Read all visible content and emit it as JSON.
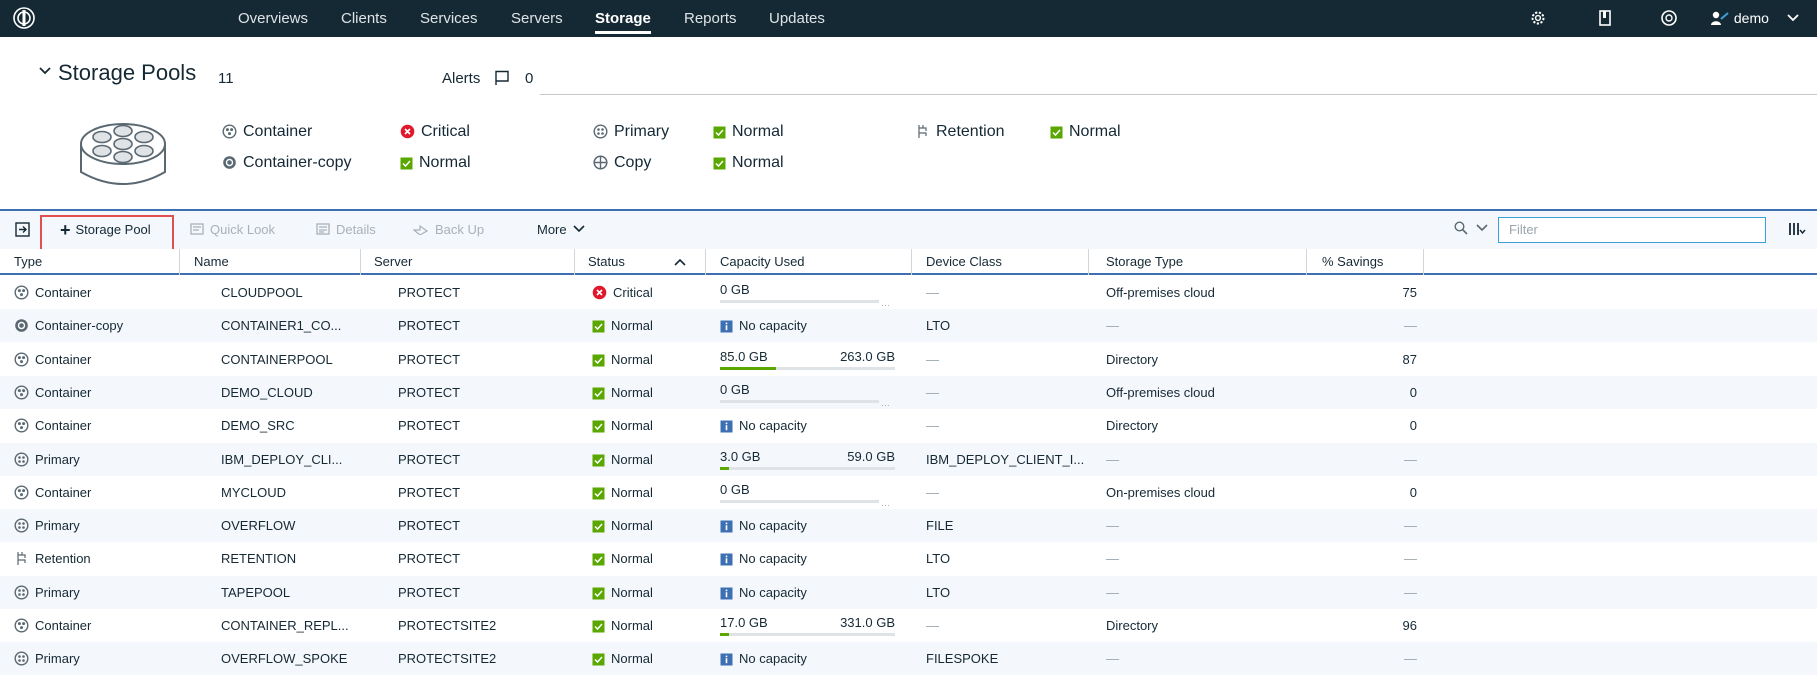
{
  "nav": {
    "items": [
      {
        "label": "Overviews"
      },
      {
        "label": "Clients"
      },
      {
        "label": "Services"
      },
      {
        "label": "Servers"
      },
      {
        "label": "Storage"
      },
      {
        "label": "Reports"
      },
      {
        "label": "Updates"
      }
    ],
    "active": "Storage",
    "user": "demo",
    "icons": [
      "gear-icon",
      "book-icon",
      "globe-icon",
      "user-icon"
    ]
  },
  "header": {
    "title": "Storage Pools",
    "count": "11",
    "alerts_label": "Alerts",
    "alerts_count": "0"
  },
  "summary": {
    "types": [
      {
        "label": "Container",
        "icon": "container-icon",
        "status": "Critical"
      },
      {
        "label": "Container-copy",
        "icon": "container-copy-icon",
        "status": "Normal"
      },
      {
        "label": "Primary",
        "icon": "primary-icon",
        "status": "Normal"
      },
      {
        "label": "Copy",
        "icon": "copy-icon",
        "status": "Normal"
      },
      {
        "label": "Retention",
        "icon": "retention-icon",
        "status": "Normal"
      }
    ]
  },
  "toolbar": {
    "add_storage_pool": "Storage Pool",
    "quick_look": "Quick Look",
    "details": "Details",
    "back_up": "Back Up",
    "more": "More",
    "filter_placeholder": "Filter"
  },
  "table": {
    "columns": [
      "Type",
      "Name",
      "Server",
      "Status",
      "Capacity Used",
      "Device Class",
      "Storage Type",
      "% Savings"
    ],
    "no_capacity_label": "No capacity",
    "rows": [
      {
        "type": "Container",
        "name": "CLOUDPOOL",
        "server": "PROTECT",
        "status": "Critical",
        "cap_used": "0 GB",
        "cap_total": "",
        "cap_fraction": 0,
        "cap_kind": "dotted",
        "device_class": "—",
        "storage_type": "Off-premises cloud",
        "savings": "75"
      },
      {
        "type": "Container-copy",
        "name": "CONTAINER1_CO...",
        "server": "PROTECT",
        "status": "Normal",
        "cap_used": "",
        "cap_total": "",
        "cap_fraction": 0,
        "cap_kind": "none",
        "device_class": "LTO",
        "storage_type": "—",
        "savings": "—"
      },
      {
        "type": "Container",
        "name": "CONTAINERPOOL",
        "server": "PROTECT",
        "status": "Normal",
        "cap_used": "85.0 GB",
        "cap_total": "263.0 GB",
        "cap_fraction": 0.32,
        "cap_kind": "bar",
        "device_class": "—",
        "storage_type": "Directory",
        "savings": "87"
      },
      {
        "type": "Container",
        "name": "DEMO_CLOUD",
        "server": "PROTECT",
        "status": "Normal",
        "cap_used": "0 GB",
        "cap_total": "",
        "cap_fraction": 0,
        "cap_kind": "dotted",
        "device_class": "—",
        "storage_type": "Off-premises cloud",
        "savings": "0"
      },
      {
        "type": "Container",
        "name": "DEMO_SRC",
        "server": "PROTECT",
        "status": "Normal",
        "cap_used": "",
        "cap_total": "",
        "cap_fraction": 0,
        "cap_kind": "none",
        "device_class": "—",
        "storage_type": "Directory",
        "savings": "0"
      },
      {
        "type": "Primary",
        "name": "IBM_DEPLOY_CLI...",
        "server": "PROTECT",
        "status": "Normal",
        "cap_used": "3.0 GB",
        "cap_total": "59.0 GB",
        "cap_fraction": 0.05,
        "cap_kind": "bar",
        "device_class": "IBM_DEPLOY_CLIENT_I...",
        "storage_type": "—",
        "savings": "—"
      },
      {
        "type": "Container",
        "name": "MYCLOUD",
        "server": "PROTECT",
        "status": "Normal",
        "cap_used": "0 GB",
        "cap_total": "",
        "cap_fraction": 0,
        "cap_kind": "dotted",
        "device_class": "—",
        "storage_type": "On-premises cloud",
        "savings": "0"
      },
      {
        "type": "Primary",
        "name": "OVERFLOW",
        "server": "PROTECT",
        "status": "Normal",
        "cap_used": "",
        "cap_total": "",
        "cap_fraction": 0,
        "cap_kind": "none",
        "device_class": "FILE",
        "storage_type": "—",
        "savings": "—"
      },
      {
        "type": "Retention",
        "name": "RETENTION",
        "server": "PROTECT",
        "status": "Normal",
        "cap_used": "",
        "cap_total": "",
        "cap_fraction": 0,
        "cap_kind": "none",
        "device_class": "LTO",
        "storage_type": "—",
        "savings": "—"
      },
      {
        "type": "Primary",
        "name": "TAPEPOOL",
        "server": "PROTECT",
        "status": "Normal",
        "cap_used": "",
        "cap_total": "",
        "cap_fraction": 0,
        "cap_kind": "none",
        "device_class": "LTO",
        "storage_type": "—",
        "savings": "—"
      },
      {
        "type": "Container",
        "name": "CONTAINER_REPL...",
        "server": "PROTECTSITE2",
        "status": "Normal",
        "cap_used": "17.0 GB",
        "cap_total": "331.0 GB",
        "cap_fraction": 0.05,
        "cap_kind": "bar",
        "device_class": "—",
        "storage_type": "Directory",
        "savings": "96"
      },
      {
        "type": "Primary",
        "name": "OVERFLOW_SPOKE",
        "server": "PROTECTSITE2",
        "status": "Normal",
        "cap_used": "",
        "cap_total": "",
        "cap_fraction": 0,
        "cap_kind": "none",
        "device_class": "FILESPOKE",
        "storage_type": "—",
        "savings": "—"
      }
    ]
  },
  "colors": {
    "nav_bg": "#152935",
    "accent": "#3d70b2",
    "critical": "#e0182d",
    "normal": "#5aa700",
    "info": "#3d70b2"
  }
}
